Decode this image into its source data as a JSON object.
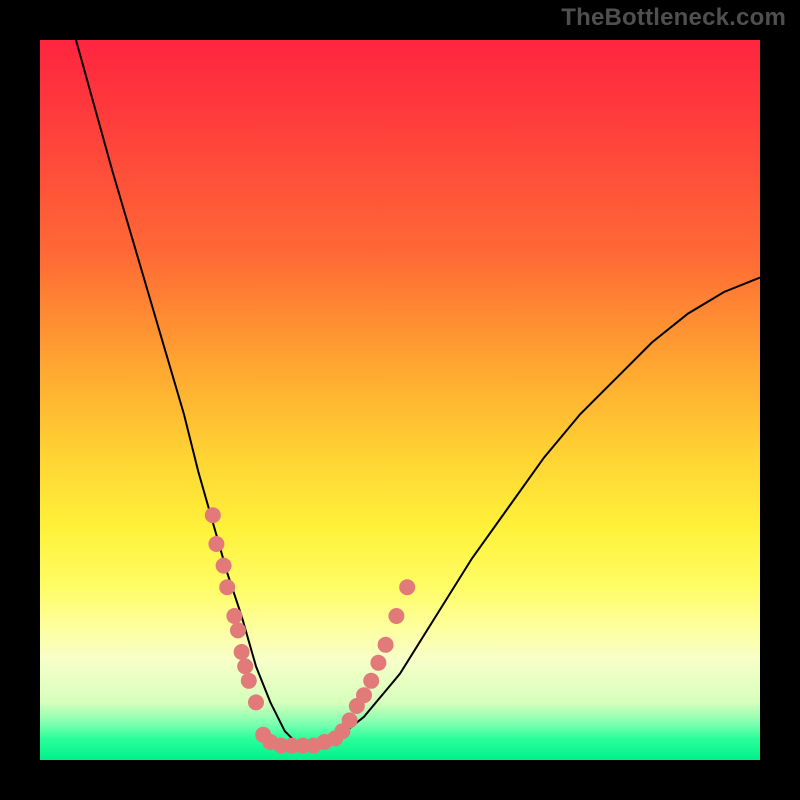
{
  "watermark": "TheBottleneck.com",
  "chart_data": {
    "type": "line",
    "title": "",
    "xlabel": "",
    "ylabel": "",
    "xlim": [
      0,
      100
    ],
    "ylim": [
      0,
      100
    ],
    "legend": false,
    "grid": false,
    "background_gradient": {
      "direction": "vertical",
      "stops": [
        {
          "pos": 0.0,
          "color": "#ff253f"
        },
        {
          "pos": 0.3,
          "color": "#ff6a35"
        },
        {
          "pos": 0.58,
          "color": "#ffd433"
        },
        {
          "pos": 0.82,
          "color": "#fdffa2"
        },
        {
          "pos": 1.0,
          "color": "#00f08a"
        }
      ]
    },
    "series": [
      {
        "name": "bottleneck-curve",
        "x": [
          5,
          10,
          15,
          20,
          22,
          24,
          26,
          28,
          30,
          32,
          34,
          36,
          40,
          45,
          50,
          55,
          60,
          65,
          70,
          75,
          80,
          85,
          90,
          95,
          100
        ],
        "y": [
          100,
          82,
          65,
          48,
          40,
          33,
          26,
          20,
          13,
          8,
          4,
          2,
          2,
          6,
          12,
          20,
          28,
          35,
          42,
          48,
          53,
          58,
          62,
          65,
          67
        ]
      }
    ],
    "scatter_points": {
      "name": "sample-dots",
      "color": "#e27a7a",
      "radius_px": 8,
      "points": [
        {
          "x": 24.0,
          "y": 34.0
        },
        {
          "x": 24.5,
          "y": 30.0
        },
        {
          "x": 25.5,
          "y": 27.0
        },
        {
          "x": 26.0,
          "y": 24.0
        },
        {
          "x": 27.0,
          "y": 20.0
        },
        {
          "x": 27.5,
          "y": 18.0
        },
        {
          "x": 28.0,
          "y": 15.0
        },
        {
          "x": 28.5,
          "y": 13.0
        },
        {
          "x": 29.0,
          "y": 11.0
        },
        {
          "x": 30.0,
          "y": 8.0
        },
        {
          "x": 31.0,
          "y": 3.5
        },
        {
          "x": 32.0,
          "y": 2.5
        },
        {
          "x": 33.5,
          "y": 2.0
        },
        {
          "x": 35.0,
          "y": 2.0
        },
        {
          "x": 36.5,
          "y": 2.0
        },
        {
          "x": 38.0,
          "y": 2.0
        },
        {
          "x": 39.5,
          "y": 2.5
        },
        {
          "x": 41.0,
          "y": 3.0
        },
        {
          "x": 42.0,
          "y": 4.0
        },
        {
          "x": 43.0,
          "y": 5.5
        },
        {
          "x": 44.0,
          "y": 7.5
        },
        {
          "x": 45.0,
          "y": 9.0
        },
        {
          "x": 46.0,
          "y": 11.0
        },
        {
          "x": 47.0,
          "y": 13.5
        },
        {
          "x": 48.0,
          "y": 16.0
        },
        {
          "x": 49.5,
          "y": 20.0
        },
        {
          "x": 51.0,
          "y": 24.0
        }
      ]
    }
  }
}
